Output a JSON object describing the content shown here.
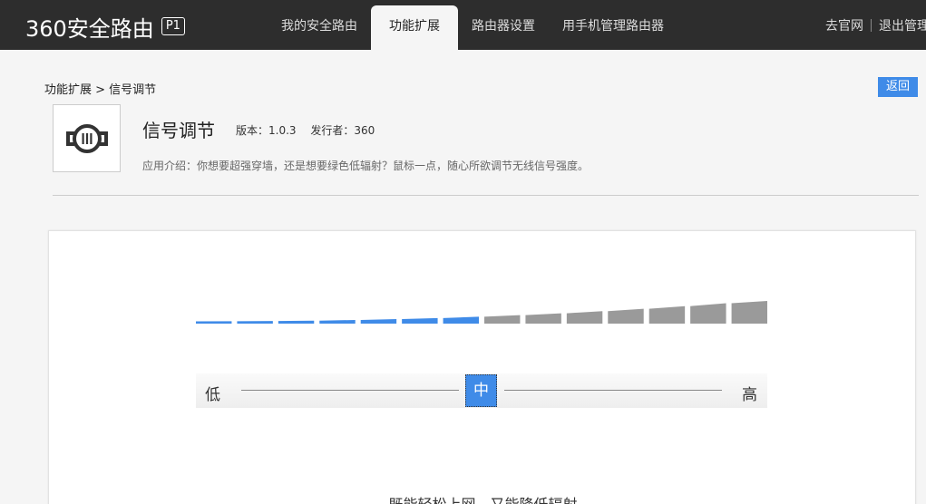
{
  "header": {
    "logo_text": "360安全路由",
    "logo_badge": "P1",
    "tabs": [
      {
        "label": "我的安全路由"
      },
      {
        "label": "功能扩展"
      },
      {
        "label": "路由器设置"
      },
      {
        "label": "用手机管理路由器"
      }
    ],
    "links": {
      "official": "去官网",
      "logout": "退出管理"
    }
  },
  "breadcrumb": "功能扩展 > 信号调节",
  "back_label": "返回",
  "app": {
    "icon": "signal-adjust-icon",
    "title": "信号调节",
    "version": "版本：1.0.3",
    "publisher": "发行者：360",
    "description": "应用介绍：你想要超强穿墙，还是想要绿色低辐射？鼠标一点，随心所欲调节无线信号强度。"
  },
  "signal": {
    "total_levels": 14,
    "active_levels": 7,
    "low_label": "低",
    "mid_label": "中",
    "high_label": "高",
    "caption": "既能轻松上网，又能降低辐射"
  },
  "colors": {
    "active": "#3f8be8",
    "inactive": "#9a9a9a",
    "topbar": "#2d2d2d"
  }
}
